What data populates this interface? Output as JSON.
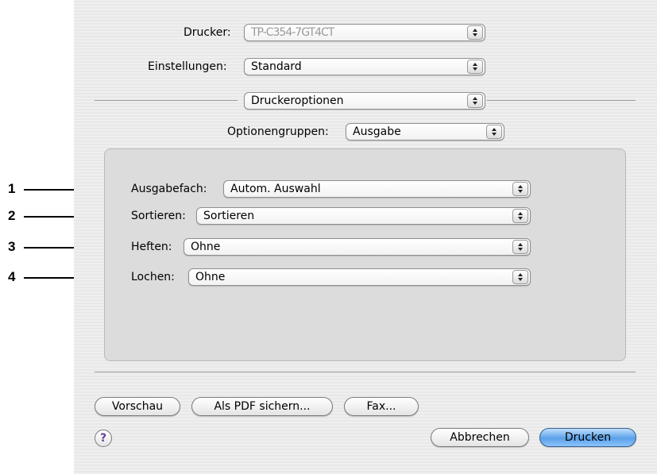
{
  "header": {
    "printer_label": "Drucker:",
    "printer_value": "TP-C354-7GT4CT",
    "presets_label": "Einstellungen:",
    "presets_value": "Standard"
  },
  "section_popup": "Druckeroptionen",
  "option_groups": {
    "label": "Optionengruppen:",
    "value": "Ausgabe"
  },
  "options": [
    {
      "callout": "1",
      "label": "Ausgabefach:",
      "value": "Autom. Auswahl"
    },
    {
      "callout": "2",
      "label": "Sortieren:",
      "value": "Sortieren"
    },
    {
      "callout": "3",
      "label": "Heften:",
      "value": "Ohne"
    },
    {
      "callout": "4",
      "label": "Lochen:",
      "value": "Ohne"
    }
  ],
  "buttons": {
    "preview": "Vorschau",
    "save_pdf": "Als PDF sichern...",
    "fax": "Fax...",
    "help": "?",
    "cancel": "Abbrechen",
    "print": "Drucken"
  },
  "colors": {
    "default_button": "#5aa0e8",
    "dialog_background": "#ececec"
  }
}
